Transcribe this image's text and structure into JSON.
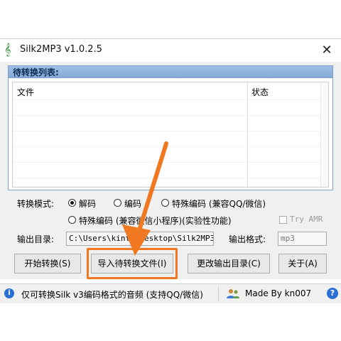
{
  "window": {
    "title": "Silk2MP3 v1.0.2.5",
    "close_glyph": "✕"
  },
  "list": {
    "header": "待转换列表:",
    "columns": [
      "文件",
      "状态"
    ]
  },
  "mode": {
    "label": "转换模式:",
    "options": [
      "解码",
      "编码",
      "特殊编码 (兼容QQ/微信)",
      "特殊编码 (兼容微信小程序)(实验性功能)"
    ],
    "selected": "解码",
    "try_amr": "Try AMR"
  },
  "output": {
    "dir_label": "输出目录:",
    "dir_value": "C:\\Users\\kinth\\Desktop\\Silk2MP3\\",
    "format_label": "输出格式:",
    "format_value": "mp3"
  },
  "buttons": {
    "start": "开始转换(S)",
    "import": "导入待转换文件(I)",
    "change_dir": "更改输出目录(C)",
    "about": "关于(A)"
  },
  "status": {
    "info": "仅可转换Silk v3编码格式的音频 (支持QQ/微信)",
    "made_by": "Made By kn007",
    "help": "?"
  },
  "colors": {
    "accent_orange": "#f07820",
    "group_header": "#9ec0e6",
    "info_blue": "#2a6fd1"
  },
  "icons": [
    "music-note-icon",
    "close-icon",
    "info-icon",
    "users-icon",
    "help-icon",
    "arrow-annotation"
  ]
}
